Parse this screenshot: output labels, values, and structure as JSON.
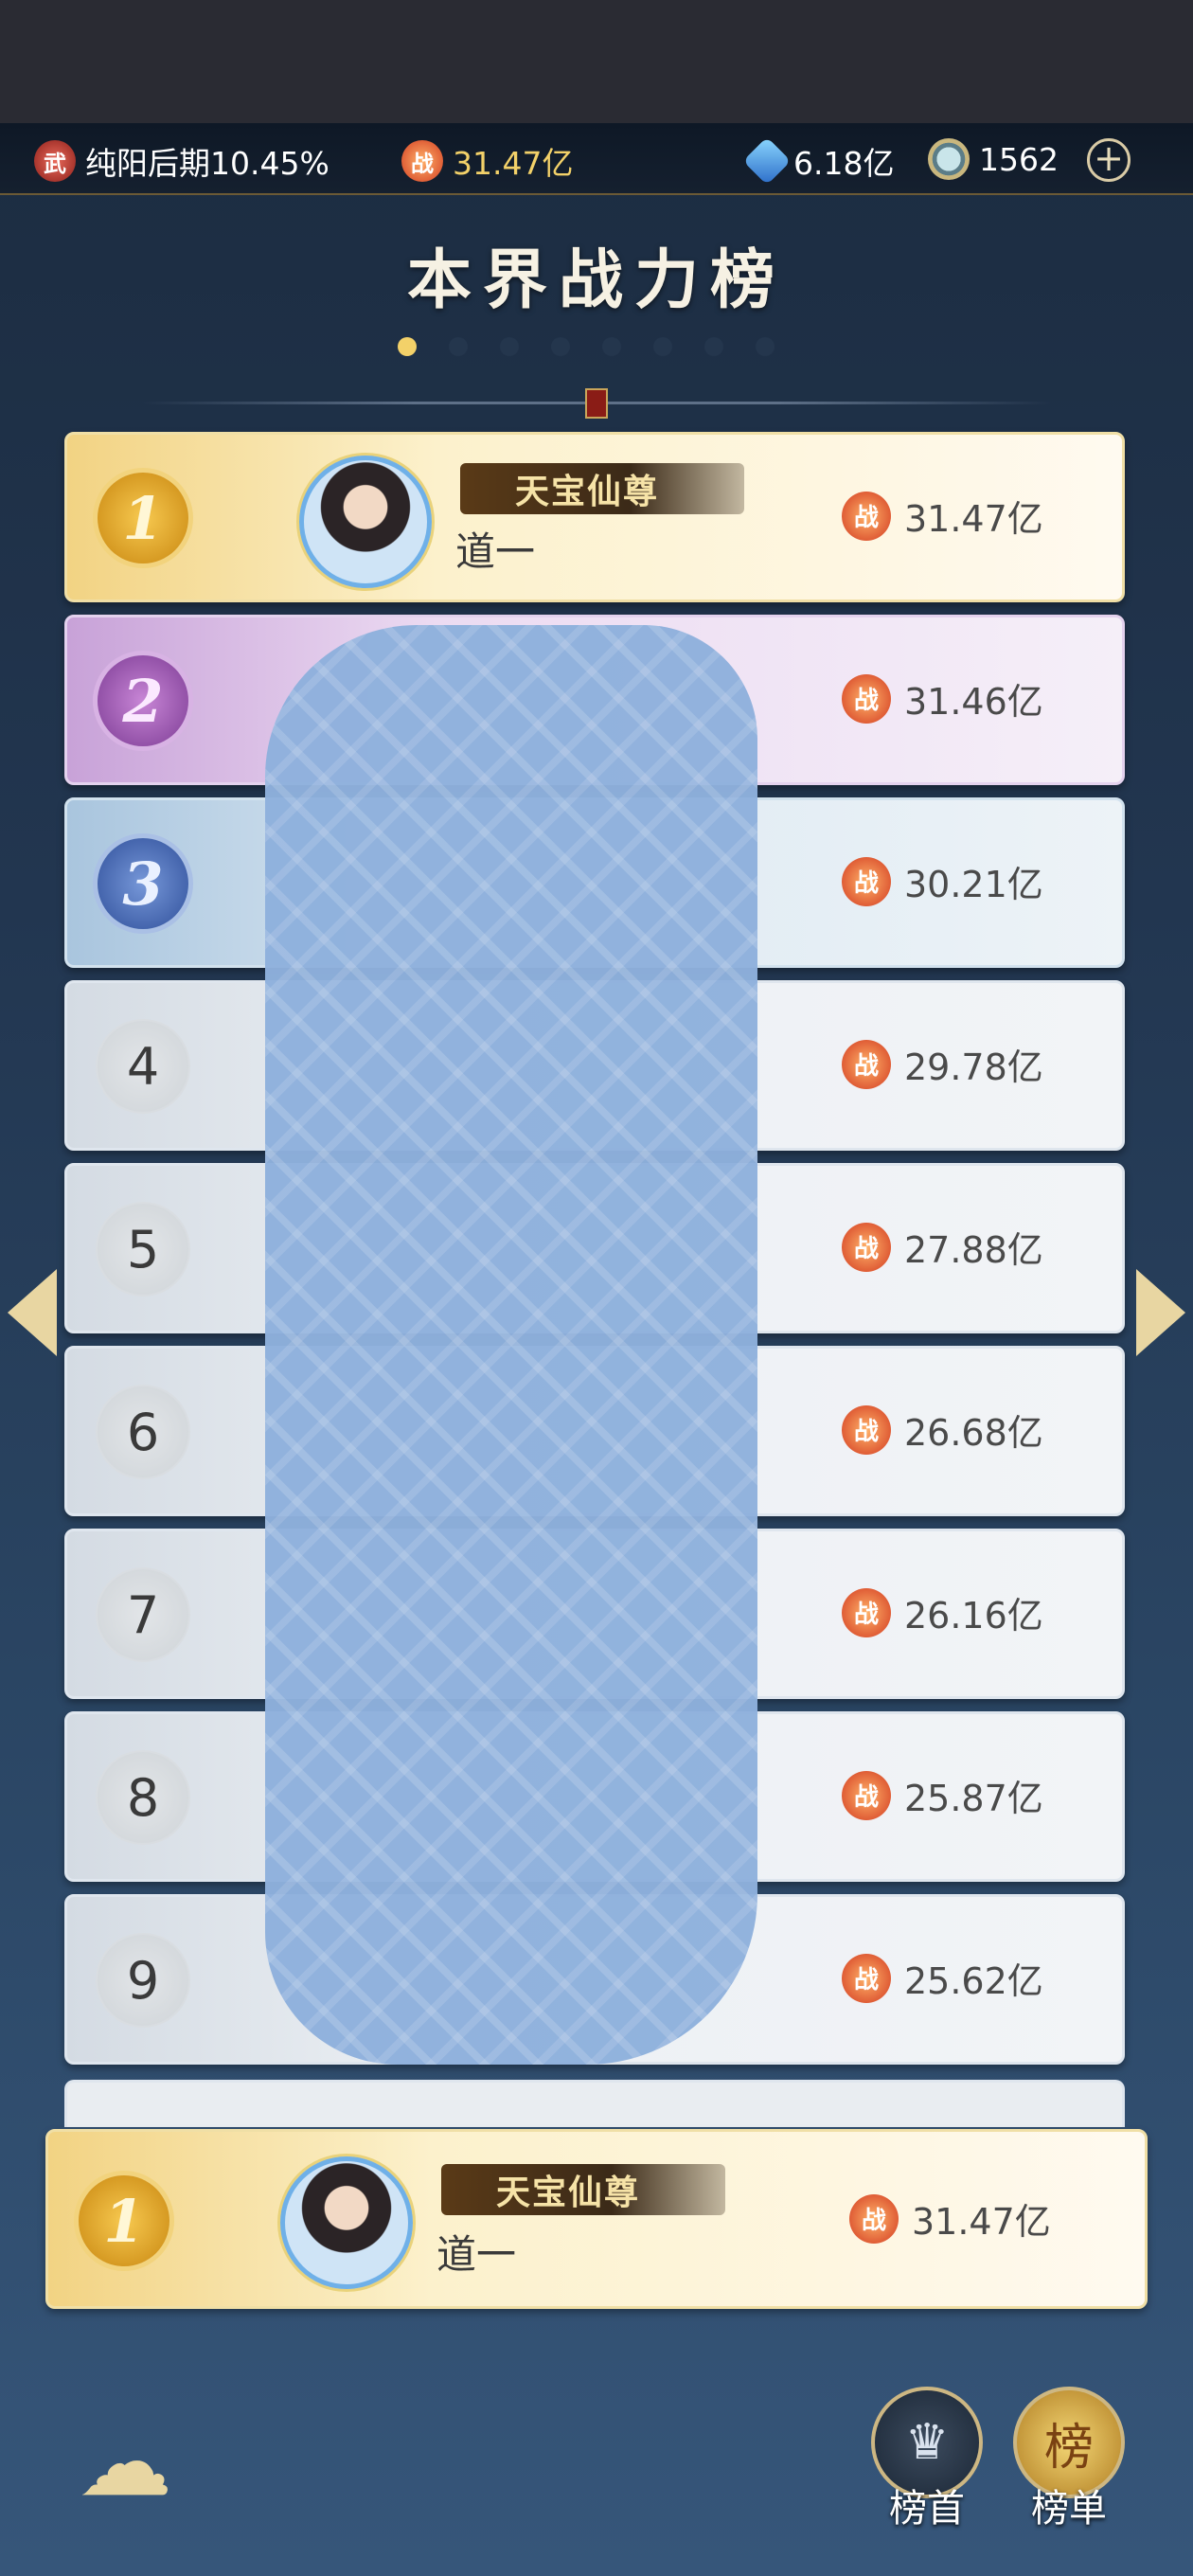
{
  "status_bar": {
    "realm_icon_char": "武",
    "realm_text": "纯阳后期10.45%",
    "power_icon_char": "战",
    "power_text": "31.47亿",
    "gem_value": "6.18亿",
    "coin_value": "1562",
    "plus_icon": "plus-icon"
  },
  "page": {
    "title": "本界战力榜",
    "page_dots": 8,
    "active_dot": 1
  },
  "power_icon_char": "战",
  "rankings": [
    {
      "rank": "1",
      "name": "道一",
      "title_badge": "天宝仙尊",
      "power": "31.47亿"
    },
    {
      "rank": "2",
      "name": "",
      "title_badge": "",
      "power": "31.46亿"
    },
    {
      "rank": "3",
      "name": "",
      "title_badge": "",
      "power": "30.21亿"
    },
    {
      "rank": "4",
      "name": "",
      "title_badge": "",
      "power": "29.78亿"
    },
    {
      "rank": "5",
      "name": "",
      "title_badge": "",
      "power": "27.88亿"
    },
    {
      "rank": "6",
      "name": "",
      "title_badge": "",
      "power": "26.68亿"
    },
    {
      "rank": "7",
      "name": "",
      "title_badge": "",
      "power": "26.16亿"
    },
    {
      "rank": "8",
      "name": "",
      "title_badge": "",
      "power": "25.87亿"
    },
    {
      "rank": "9",
      "name": "",
      "title_badge": "",
      "power": "25.62亿"
    }
  ],
  "my_rank": {
    "rank": "1",
    "name": "道一",
    "title_badge": "天宝仙尊",
    "power": "31.47亿"
  },
  "bottom_nav": {
    "head_label": "榜首",
    "head_icon": "dragon-icon",
    "list_label": "榜单",
    "list_icon": "scroll-icon",
    "list_icon_char": "榜"
  },
  "colors": {
    "gold_accent": "#f3d169",
    "status_bar_bg": "#0e1826",
    "rank1_bg": "#f2d383",
    "rank2_bg": "#c8a2d8",
    "rank3_bg": "#a9c5de"
  }
}
